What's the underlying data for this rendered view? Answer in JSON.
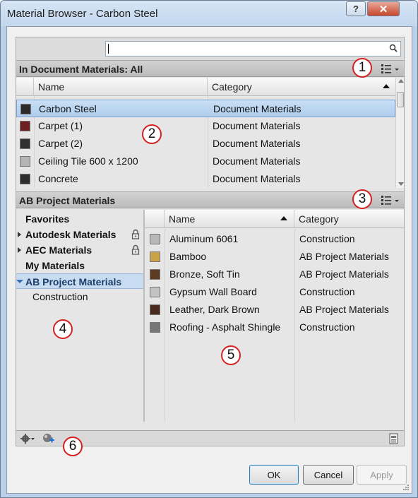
{
  "window": {
    "title": "Material Browser - Carbon Steel",
    "help_glyph": "?",
    "close_glyph": "✕"
  },
  "search": {
    "placeholder": "",
    "value": ""
  },
  "document_section": {
    "title": "In Document Materials: All",
    "columns": {
      "name": "Name",
      "category": "Category"
    },
    "rows": [
      {
        "name": "Carbon Steel",
        "category": "Document Materials",
        "swatch": "#2a2a2a",
        "selected": true
      },
      {
        "name": "Carpet (1)",
        "category": "Document Materials",
        "swatch": "#6e1f22",
        "selected": false
      },
      {
        "name": "Carpet (2)",
        "category": "Document Materials",
        "swatch": "#303030",
        "selected": false
      },
      {
        "name": "Ceiling Tile 600 x 1200",
        "category": "Document Materials",
        "swatch": "#b4b4b4",
        "selected": false
      },
      {
        "name": "Concrete",
        "category": "Document Materials",
        "swatch": "#2e2e2e",
        "selected": false
      }
    ]
  },
  "library_section": {
    "title": "AB Project Materials",
    "tree": [
      {
        "label": "Favorites",
        "expander": "none",
        "locked": false,
        "selected": false,
        "child": false
      },
      {
        "label": "Autodesk Materials",
        "expander": "closed",
        "locked": true,
        "selected": false,
        "child": false
      },
      {
        "label": "AEC Materials",
        "expander": "closed",
        "locked": true,
        "selected": false,
        "child": false
      },
      {
        "label": "My Materials",
        "expander": "none",
        "locked": false,
        "selected": false,
        "child": false
      },
      {
        "label": "AB Project Materials",
        "expander": "open",
        "locked": false,
        "selected": true,
        "child": false
      },
      {
        "label": "Construction",
        "expander": "none",
        "locked": false,
        "selected": false,
        "child": true
      }
    ],
    "columns": {
      "name": "Name",
      "category": "Category"
    },
    "rows": [
      {
        "name": "Aluminum 6061",
        "category": "Construction",
        "swatch": "#b8b8b8"
      },
      {
        "name": "Bamboo",
        "category": "AB Project Materials",
        "swatch": "#c9a24a"
      },
      {
        "name": "Bronze, Soft Tin",
        "category": "AB Project Materials",
        "swatch": "#5c3b22"
      },
      {
        "name": "Gypsum Wall Board",
        "category": "Construction",
        "swatch": "#c2c2c2"
      },
      {
        "name": "Leather, Dark Brown",
        "category": "AB Project Materials",
        "swatch": "#4a2a1e"
      },
      {
        "name": "Roofing - Asphalt Shingle",
        "category": "Construction",
        "swatch": "#777777"
      }
    ]
  },
  "callouts": [
    "1",
    "2",
    "3",
    "4",
    "5",
    "6"
  ],
  "buttons": {
    "ok": "OK",
    "cancel": "Cancel",
    "apply": "Apply"
  },
  "colors": {
    "selection": "#aecdec",
    "callout_ring": "#d42020"
  }
}
